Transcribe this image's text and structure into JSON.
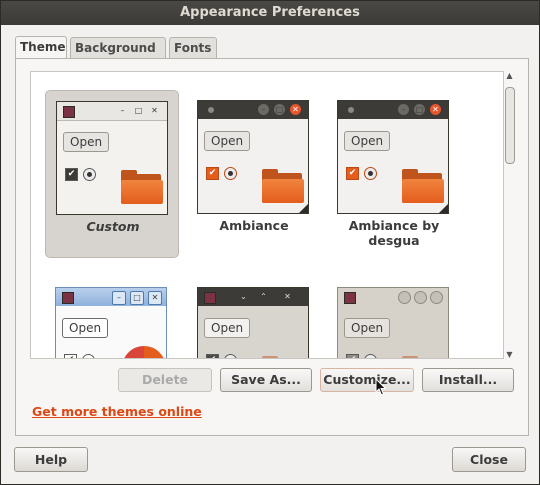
{
  "window": {
    "title": "Appearance Preferences"
  },
  "tabs": [
    {
      "label": "Theme",
      "active": true
    },
    {
      "label": "Background",
      "active": false
    },
    {
      "label": "Fonts",
      "active": false
    }
  ],
  "themes": [
    {
      "name": "Custom",
      "selected": true,
      "open_label": "Open"
    },
    {
      "name": "Ambiance",
      "selected": false,
      "open_label": "Open"
    },
    {
      "name": "Ambiance by desgua",
      "selected": false,
      "open_label": "Open"
    },
    {
      "name": "",
      "selected": false,
      "open_label": "Open"
    },
    {
      "name": "",
      "selected": false,
      "open_label": "Open"
    },
    {
      "name": "",
      "selected": false,
      "open_label": "Open"
    }
  ],
  "actions": {
    "delete": {
      "label": "Delete",
      "enabled": false
    },
    "save_as": {
      "label": "Save As..."
    },
    "customize": {
      "label": "Customize..."
    },
    "install": {
      "label": "Install..."
    }
  },
  "link": {
    "text": "Get more themes online"
  },
  "footer": {
    "help": "Help",
    "close": "Close"
  },
  "colors": {
    "accent": "#dd4814",
    "titlebar": "#3c3b37",
    "selection": "#d7d4cf",
    "folder": "#e45d1d"
  }
}
